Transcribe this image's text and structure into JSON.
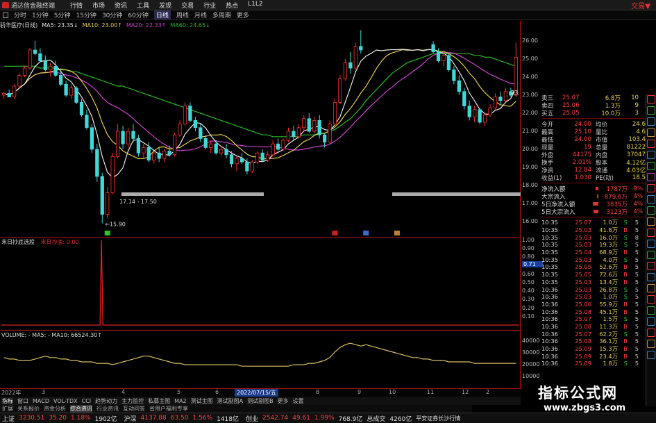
{
  "titlebar": {
    "app_title": "通达信金融终端",
    "menu": [
      "行情",
      "市场",
      "资讯",
      "工具",
      "发现",
      "交易",
      "行业",
      "热点",
      "L1L2"
    ],
    "right": "交易▼"
  },
  "periods": [
    {
      "label": "分时",
      "active": false
    },
    {
      "label": "1分钟",
      "active": false
    },
    {
      "label": "5分钟",
      "active": false
    },
    {
      "label": "15分钟",
      "active": false
    },
    {
      "label": "30分钟",
      "active": false
    },
    {
      "label": "60分钟",
      "active": false
    },
    {
      "label": "日线",
      "active": true
    },
    {
      "label": "周线",
      "active": false
    },
    {
      "label": "月线",
      "active": false
    },
    {
      "label": "多周期",
      "active": false
    },
    {
      "label": "更多",
      "active": false
    }
  ],
  "indicator_line": {
    "name": "骄华医疗(日线)",
    "ma5": "MA5: 23.35↓",
    "ma10": "MA10: 23.00↑",
    "ma20": "MA20: 22.33↑",
    "ma60": "MA60: 24.65↓"
  },
  "colors": {
    "ma5": "#e8e8e8",
    "ma10": "#e8d048",
    "ma20": "#cc44cc",
    "ma60": "#28b828",
    "up": "#ff3030",
    "down": "#40d8d8",
    "border": "#b01010",
    "volume_line": "#d8c060"
  },
  "price_axis": [
    "26.00",
    "25.00",
    "24.00",
    "23.00",
    "22.00",
    "21.00",
    "20.00",
    "19.00",
    "18.00",
    "17.00",
    "16.00"
  ],
  "price_annotations": {
    "low": "15.90",
    "range": "17.14 - 17.50",
    "last_partial": "23"
  },
  "indicator_pane": {
    "name": "末日抄底选股",
    "sub": "末日抄底: 0.00",
    "axis": [
      "1.00",
      "0.90",
      "0.80",
      "0.71",
      "0.60",
      "0.50",
      "0.40",
      "0.30",
      "0.20",
      "0.10"
    ],
    "current": "0.71"
  },
  "volume_pane": {
    "label": "VOLUME: - MA5: - MA10: 66524.30↑",
    "axis": [
      "40000",
      "30000",
      "20000",
      "10000"
    ]
  },
  "date_axis": {
    "labels": [
      "2022年",
      "3",
      "4",
      "5",
      "6",
      "7",
      "8",
      "9",
      "10",
      "11",
      "12",
      "2"
    ],
    "highlight": "2022/07/15/五"
  },
  "tabs1": [
    "指标",
    "窗口",
    "MACD",
    "VOL-TDX",
    "CCI",
    "趋势动力",
    "主力监控",
    "私募主图",
    "MA2",
    "测试主图",
    "测试副图A",
    "测试副图B",
    "更多",
    "设置"
  ],
  "tabs2": [
    "扩展",
    "关系报价",
    "资金分析",
    "综合资讯",
    "行业资讯",
    "互动问答",
    "省用户福利专享"
  ],
  "quote_panel": {
    "levels": [
      {
        "name": "卖三",
        "price": "25.07",
        "vol": "6.8万",
        "n": "10"
      },
      {
        "name": "卖四",
        "price": "25.06",
        "vol": "1.3万",
        "n": "9"
      },
      {
        "name": "买五",
        "price": "25.05",
        "vol": "10.0万",
        "n": "3"
      }
    ],
    "stats": [
      {
        "k1": "今开",
        "v1": "24.00",
        "k2": "均价",
        "v2": "24.6"
      },
      {
        "k1": "最高",
        "v1": "25.10",
        "k2": "量比",
        "v2": "4.6"
      },
      {
        "k1": "最低",
        "v1": "24.00",
        "k2": "市值",
        "v2": "103.4"
      },
      {
        "k1": "现量",
        "v1": "19",
        "k2": "总量",
        "v2": "81222"
      },
      {
        "k1": "外盘",
        "v1": "44175",
        "k2": "内盘",
        "v2": "37047"
      },
      {
        "k1": "换手",
        "v1": "2.01%",
        "k2": "股本",
        "v2": "4.12亿"
      },
      {
        "k1": "净资",
        "v1": "12.84",
        "k2": "流通",
        "v2": "4.03亿"
      },
      {
        "k1": "收益(1)",
        "v1": "1.030",
        "k2": "PE(动)",
        "v2": "18.5"
      }
    ],
    "flows": [
      {
        "label": "净流入额",
        "value": "1787万",
        "pct": "9%",
        "bar": 0.2
      },
      {
        "label": "大宗流入",
        "value": "879.6万",
        "pct": "4%",
        "bar": 0.1
      },
      {
        "label": "5日净流入额",
        "value": "3835万",
        "pct": "4%",
        "bar": 0.4
      },
      {
        "label": "5日大宗流入",
        "value": "3123万",
        "pct": "4%",
        "bar": 0.35
      }
    ],
    "ticks": [
      {
        "t": "10:35",
        "p": "25.07",
        "v": "1.0万",
        "s": "S",
        "n": "5"
      },
      {
        "t": "10:35",
        "p": "25.03",
        "v": "41.8万",
        "s": "B",
        "n": "5"
      },
      {
        "t": "10:35",
        "p": "25.03",
        "v": "16.0万",
        "s": "S",
        "n": "8"
      },
      {
        "t": "10:35",
        "p": "25.03",
        "v": "19.3万",
        "s": "S",
        "n": "5"
      },
      {
        "t": "10:35",
        "p": "25.04",
        "v": "68.9万",
        "s": "B",
        "n": "5"
      },
      {
        "t": "10:35",
        "p": "25.03",
        "v": "4.0万",
        "s": "S",
        "n": "5"
      },
      {
        "t": "10:35",
        "p": "25.05",
        "v": "52.6万",
        "s": "B",
        "n": "5"
      },
      {
        "t": "10:35",
        "p": "25.05",
        "v": "72.6万",
        "s": "B",
        "n": "5"
      },
      {
        "t": "10:35",
        "p": "25.03",
        "v": "13.4万",
        "s": "B",
        "n": "5"
      },
      {
        "t": "10:36",
        "p": "25.03",
        "v": "26.8万",
        "s": "S",
        "n": "5"
      },
      {
        "t": "10:36",
        "p": "25.03",
        "v": "1.0万",
        "s": "S",
        "n": "5"
      },
      {
        "t": "10:36",
        "p": "25.06",
        "v": "55.9万",
        "s": "B",
        "n": "5"
      },
      {
        "t": "10:36",
        "p": "25.08",
        "v": "45.1万",
        "s": "B",
        "n": "5"
      },
      {
        "t": "10:36",
        "p": "25.07",
        "v": "1.5万",
        "s": "S",
        "n": "5"
      },
      {
        "t": "10:36",
        "p": "25.08",
        "v": "11.3万",
        "s": "B",
        "n": "5"
      },
      {
        "t": "10:36",
        "p": "25.07",
        "v": "62.2万",
        "s": "S",
        "n": "5"
      },
      {
        "t": "10:36",
        "p": "25.08",
        "v": "36.1万",
        "s": "B",
        "n": "5"
      },
      {
        "t": "10:36",
        "p": "25.09",
        "v": "15.3万",
        "s": "B",
        "n": "5"
      },
      {
        "t": "10:36",
        "p": "25.09",
        "v": "23.4万",
        "s": "B",
        "n": "5"
      },
      {
        "t": "10:36",
        "p": "25.09",
        "v": "1.8万",
        "s": "S",
        "n": "5"
      }
    ]
  },
  "statusbar": [
    {
      "k": "上证",
      "v": "3230.51",
      "c": "35.20",
      "p": "1.18%",
      "amt": "1902亿"
    },
    {
      "k": "沪深",
      "v": "4137.88",
      "c": "63.50",
      "p": "1.56%",
      "amt": "1418亿"
    },
    {
      "k": "创业",
      "v": "2542.74",
      "c": "49.61",
      "p": "1.99%",
      "amt": "768.9亿"
    }
  ],
  "status_right": {
    "label": "总成交",
    "value": "4260亿",
    "broker": "平安证券长沙行情"
  },
  "watermark": {
    "title": "指标公式网",
    "url": "www.zbgs3.com"
  },
  "chart_data": {
    "type": "candlestick",
    "title": "骄华医疗(日线)",
    "ylim": [
      15.5,
      26.5
    ],
    "x_range_label": "2022",
    "low_annotation": 15.9,
    "candles": [
      [
        23.0,
        23.2,
        22.8,
        23.1
      ],
      [
        23.1,
        23.3,
        22.9,
        22.9
      ],
      [
        22.9,
        23.6,
        22.8,
        23.5
      ],
      [
        23.5,
        24.2,
        23.4,
        24.1
      ],
      [
        24.1,
        24.6,
        24.0,
        24.5
      ],
      [
        24.5,
        25.6,
        24.4,
        25.5
      ],
      [
        25.5,
        26.0,
        25.2,
        25.3
      ],
      [
        25.3,
        25.6,
        24.8,
        24.9
      ],
      [
        24.9,
        25.2,
        24.3,
        24.4
      ],
      [
        24.4,
        24.8,
        24.0,
        24.6
      ],
      [
        24.6,
        24.9,
        24.0,
        24.1
      ],
      [
        24.1,
        24.3,
        23.5,
        23.6
      ],
      [
        23.6,
        23.8,
        22.9,
        23.0
      ],
      [
        23.0,
        23.6,
        22.8,
        23.4
      ],
      [
        23.4,
        23.5,
        22.5,
        22.6
      ],
      [
        22.6,
        22.8,
        21.8,
        21.9
      ],
      [
        21.9,
        22.2,
        21.1,
        21.2
      ],
      [
        21.2,
        21.4,
        19.8,
        20.0
      ],
      [
        20.0,
        20.3,
        18.2,
        18.5
      ],
      [
        18.5,
        18.7,
        15.9,
        16.4
      ],
      [
        16.4,
        17.9,
        16.2,
        17.6
      ],
      [
        17.6,
        19.8,
        17.5,
        19.6
      ],
      [
        19.6,
        21.4,
        19.5,
        21.0
      ],
      [
        21.0,
        21.3,
        20.0,
        20.3
      ],
      [
        20.3,
        21.2,
        20.1,
        21.0
      ],
      [
        21.0,
        21.4,
        20.4,
        20.6
      ],
      [
        20.6,
        20.8,
        19.6,
        19.8
      ],
      [
        19.8,
        20.3,
        19.5,
        20.1
      ],
      [
        20.1,
        20.4,
        19.3,
        19.4
      ],
      [
        19.4,
        19.9,
        19.2,
        19.8
      ],
      [
        19.8,
        20.1,
        19.3,
        19.5
      ],
      [
        19.5,
        20.0,
        19.3,
        19.9
      ],
      [
        19.9,
        20.2,
        19.6,
        19.7
      ],
      [
        19.7,
        20.9,
        19.6,
        20.8
      ],
      [
        20.8,
        21.6,
        20.7,
        21.4
      ],
      [
        21.4,
        22.6,
        21.3,
        22.4
      ],
      [
        22.4,
        22.6,
        21.5,
        21.6
      ],
      [
        21.6,
        21.8,
        21.0,
        21.2
      ],
      [
        21.2,
        21.4,
        20.4,
        20.6
      ],
      [
        20.6,
        20.8,
        20.0,
        20.1
      ],
      [
        20.1,
        20.5,
        19.8,
        20.3
      ],
      [
        20.3,
        20.5,
        19.7,
        19.8
      ],
      [
        19.8,
        20.2,
        19.6,
        20.0
      ],
      [
        20.0,
        20.3,
        19.5,
        19.7
      ],
      [
        19.7,
        19.9,
        19.0,
        19.2
      ],
      [
        19.2,
        19.6,
        18.8,
        19.5
      ],
      [
        19.5,
        19.8,
        19.2,
        19.3
      ],
      [
        19.3,
        19.5,
        18.6,
        18.8
      ],
      [
        18.8,
        19.4,
        18.7,
        19.3
      ],
      [
        19.3,
        19.9,
        19.2,
        19.8
      ],
      [
        19.8,
        20.0,
        19.3,
        19.4
      ],
      [
        19.4,
        19.9,
        19.3,
        19.7
      ],
      [
        19.7,
        20.5,
        19.6,
        20.3
      ],
      [
        20.3,
        20.6,
        19.9,
        20.0
      ],
      [
        20.0,
        20.6,
        19.9,
        20.5
      ],
      [
        20.5,
        21.2,
        20.4,
        21.0
      ],
      [
        21.0,
        21.3,
        20.5,
        20.7
      ],
      [
        20.7,
        21.4,
        20.6,
        21.2
      ],
      [
        21.2,
        21.9,
        21.0,
        21.7
      ],
      [
        21.7,
        22.0,
        20.9,
        21.0
      ],
      [
        21.0,
        21.8,
        20.9,
        21.6
      ],
      [
        21.6,
        21.9,
        20.6,
        20.8
      ],
      [
        20.8,
        20.9,
        20.1,
        20.4
      ],
      [
        20.4,
        21.6,
        20.3,
        21.4
      ],
      [
        21.4,
        22.8,
        21.3,
        22.6
      ],
      [
        22.6,
        24.1,
        22.5,
        23.9
      ],
      [
        23.9,
        25.0,
        23.8,
        24.8
      ],
      [
        24.8,
        25.4,
        24.2,
        24.5
      ],
      [
        24.5,
        25.9,
        24.4,
        25.7
      ],
      [
        25.7,
        26.6,
        25.3,
        25.5
      ],
      [
        25.5,
        25.9,
        24.8,
        25.3
      ],
      [
        25.3,
        25.8,
        25.0,
        25.6
      ],
      [
        25.6,
        25.9,
        25.2,
        25.4
      ],
      [
        25.4,
        25.8,
        25.1,
        25.5
      ],
      [
        25.5,
        25.9,
        25.3,
        25.7
      ],
      [
        25.7,
        26.0,
        25.3,
        25.4
      ],
      [
        25.4,
        25.8,
        25.1,
        25.6
      ],
      [
        25.6,
        25.9,
        25.3,
        25.5
      ],
      [
        25.5,
        25.8,
        25.2,
        25.4
      ],
      [
        25.4,
        25.7,
        25.1,
        25.5
      ],
      [
        25.5,
        25.9,
        25.2,
        25.6
      ],
      [
        25.6,
        25.8,
        25.2,
        25.3
      ],
      [
        25.3,
        25.9,
        25.2,
        25.8
      ],
      [
        25.8,
        26.0,
        25.3,
        25.4
      ],
      [
        25.4,
        25.6,
        24.8,
        24.9
      ],
      [
        24.9,
        25.4,
        24.6,
        25.2
      ],
      [
        25.2,
        25.3,
        24.3,
        24.4
      ],
      [
        24.4,
        24.6,
        23.6,
        23.8
      ],
      [
        23.8,
        24.1,
        23.0,
        23.2
      ],
      [
        23.2,
        23.4,
        22.2,
        22.4
      ],
      [
        22.4,
        22.7,
        21.6,
        21.8
      ],
      [
        21.8,
        22.4,
        21.5,
        22.2
      ],
      [
        22.2,
        22.3,
        21.4,
        21.5
      ],
      [
        21.5,
        22.0,
        21.3,
        21.9
      ],
      [
        21.9,
        22.5,
        21.8,
        22.3
      ],
      [
        22.3,
        23.1,
        22.2,
        22.9
      ],
      [
        22.9,
        23.2,
        22.5,
        22.7
      ],
      [
        22.7,
        23.4,
        22.6,
        23.2
      ],
      [
        23.2,
        23.4,
        22.9,
        23.0
      ],
      [
        23.0,
        25.9,
        22.9,
        25.1
      ]
    ],
    "hidden_candle_index_range": [
      70,
      82
    ],
    "ma60": [
      24.6,
      24.6,
      24.6,
      24.6,
      24.6,
      24.6,
      24.6,
      24.5,
      24.5,
      24.5,
      24.5,
      24.4,
      24.4,
      24.3,
      24.3,
      24.2,
      24.1,
      24.0,
      23.9,
      23.8,
      23.7,
      23.6,
      23.5,
      23.5,
      23.4,
      23.3,
      23.2,
      23.1,
      23.0,
      22.9,
      22.8,
      22.7,
      22.6,
      22.5,
      22.4,
      22.3,
      22.2,
      22.1,
      22.0,
      21.9,
      21.8,
      21.7,
      21.6,
      21.5,
      21.4,
      21.3,
      21.2,
      21.1,
      21.0,
      20.9,
      20.8,
      20.8,
      20.7,
      20.7,
      20.7,
      20.7,
      20.7,
      20.7,
      20.8,
      20.8,
      20.8,
      20.9,
      20.9,
      21.0,
      21.1,
      21.3,
      21.5,
      21.7,
      22.0,
      22.3,
      22.7,
      23.0,
      23.3,
      23.6,
      23.9,
      24.2,
      24.4,
      24.6,
      24.8,
      24.9,
      25.0,
      25.1,
      25.2,
      25.3,
      25.3,
      25.3,
      25.3,
      25.3,
      25.3,
      25.3,
      25.3,
      25.2,
      25.2,
      25.1,
      25.1,
      25.0,
      24.9,
      24.8,
      24.7,
      24.6
    ],
    "signal_bars": {
      "positions": [
        20,
        64,
        70,
        76
      ],
      "colors": [
        "#30c030",
        "#cc2020",
        "#3070d0",
        "#c08030"
      ]
    },
    "indicator_spike_index": 21,
    "volume": [
      18,
      17,
      17,
      16,
      16,
      16,
      17,
      18,
      19,
      18,
      18,
      17,
      17,
      16,
      16,
      15,
      15,
      15,
      14,
      14,
      14,
      13,
      14,
      15,
      16,
      17,
      18,
      19,
      19,
      18,
      17,
      16,
      15,
      14,
      14,
      13,
      13,
      13,
      13,
      13,
      13,
      13,
      13,
      13,
      13,
      13,
      12,
      12,
      12,
      12,
      12,
      12,
      12,
      12,
      12,
      12,
      13,
      13,
      13,
      14,
      14,
      15,
      16,
      18,
      22,
      25,
      27,
      28,
      27,
      26,
      27,
      26,
      25,
      24,
      23,
      22,
      21,
      20,
      19,
      18,
      18,
      17,
      17,
      16,
      16,
      16,
      15,
      15,
      15,
      15,
      15,
      14,
      14,
      14,
      14,
      14,
      14,
      14,
      14,
      14
    ],
    "volume_ma10": 66524.3
  }
}
